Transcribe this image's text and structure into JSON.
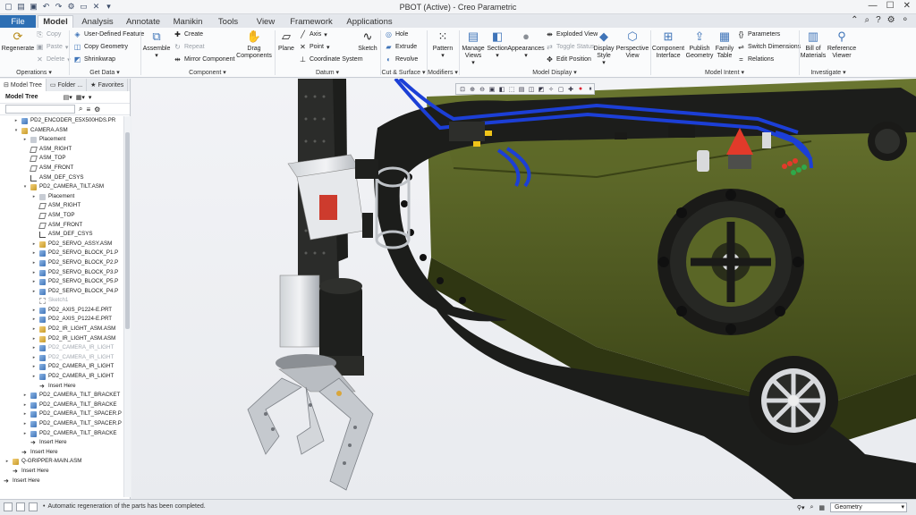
{
  "window": {
    "title": "PBOT (Active) - Creo Parametric"
  },
  "tabs": [
    "File",
    "Model",
    "Analysis",
    "Annotate",
    "Manikin",
    "Tools",
    "View",
    "Framework",
    "Applications"
  ],
  "ribbon": {
    "regenerate": "Regenerate",
    "copy": "Copy",
    "paste": "Paste",
    "delete": "Delete",
    "user_defined_feature": "User-Defined Feature",
    "copy_geometry": "Copy Geometry",
    "shrinkwrap": "Shrinkwrap",
    "assemble": "Assemble",
    "create": "Create",
    "repeat": "Repeat",
    "mirror_component": "Mirror Component",
    "drag_components": "Drag Components",
    "plane": "Plane",
    "axis": "Axis",
    "point": "Point",
    "coordinate_system": "Coordinate System",
    "sketch": "Sketch",
    "hole": "Hole",
    "extrude": "Extrude",
    "revolve": "Revolve",
    "pattern": "Pattern",
    "manage_views": "Manage Views",
    "section": "Section",
    "appearances": "Appearances",
    "exploded_view": "Exploded View",
    "toggle_status": "Toggle Status",
    "edit_position": "Edit Position",
    "display_style": "Display Style",
    "perspective_view": "Perspective View",
    "component_interface": "Component Interface",
    "publish_geometry": "Publish Geometry",
    "family_table": "Family Table",
    "parameters": "Parameters",
    "switch_dimensions": "Switch Dimensions",
    "relations": "Relations",
    "bill_of_materials": "Bill of Materials",
    "reference_viewer": "Reference Viewer",
    "groups": {
      "operations": "Operations ▾",
      "get_data": "Get Data ▾",
      "component": "Component ▾",
      "datum": "Datum ▾",
      "cut_surface": "Cut & Surface ▾",
      "modifiers": "Modifiers ▾",
      "model_display": "Model Display ▾",
      "model_intent": "Model Intent ▾",
      "investigate": "Investigate ▾"
    }
  },
  "panel": {
    "tabs": [
      "Model Tree",
      "Folder ...",
      "Favorites"
    ],
    "title": "Model Tree"
  },
  "tree": [
    {
      "label": "PD2_ENCODER_E5X500HDS.PR",
      "indent": 1,
      "type": "part",
      "exp": "▸"
    },
    {
      "label": "CAMERA.ASM",
      "indent": 1,
      "type": "asm",
      "exp": "▾"
    },
    {
      "label": "Placement",
      "indent": 2,
      "type": "plc",
      "exp": "▸"
    },
    {
      "label": "ASM_RIGHT",
      "indent": 2,
      "type": "datum",
      "exp": ""
    },
    {
      "label": "ASM_TOP",
      "indent": 2,
      "type": "datum",
      "exp": ""
    },
    {
      "label": "ASM_FRONT",
      "indent": 2,
      "type": "datum",
      "exp": ""
    },
    {
      "label": "ASM_DEF_CSYS",
      "indent": 2,
      "type": "csys",
      "exp": ""
    },
    {
      "label": "PD2_CAMERA_TILT.ASM",
      "indent": 2,
      "type": "asm",
      "exp": "▾"
    },
    {
      "label": "Placement",
      "indent": 3,
      "type": "plc",
      "exp": "▸"
    },
    {
      "label": "ASM_RIGHT",
      "indent": 3,
      "type": "datum",
      "exp": ""
    },
    {
      "label": "ASM_TOP",
      "indent": 3,
      "type": "datum",
      "exp": ""
    },
    {
      "label": "ASM_FRONT",
      "indent": 3,
      "type": "datum",
      "exp": ""
    },
    {
      "label": "ASM_DEF_CSYS",
      "indent": 3,
      "type": "csys",
      "exp": ""
    },
    {
      "label": "PD2_SERVO_ASSY.ASM",
      "indent": 3,
      "type": "asm",
      "exp": "▸"
    },
    {
      "label": "PD2_SERVO_BLOCK_P1.P",
      "indent": 3,
      "type": "part",
      "exp": "▸"
    },
    {
      "label": "PD2_SERVO_BLOCK_P2.P",
      "indent": 3,
      "type": "part",
      "exp": "▸"
    },
    {
      "label": "PD2_SERVO_BLOCK_P3.P",
      "indent": 3,
      "type": "part",
      "exp": "▸"
    },
    {
      "label": "PD2_SERVO_BLOCK_P5.P",
      "indent": 3,
      "type": "part",
      "exp": "▸"
    },
    {
      "label": "PD2_SERVO_BLOCK_P4.P",
      "indent": 3,
      "type": "part",
      "exp": "▸"
    },
    {
      "label": "Sketch1",
      "indent": 3,
      "type": "skt",
      "exp": "",
      "dim": true
    },
    {
      "label": "PD2_AXIS_P1224-E.PRT",
      "indent": 3,
      "type": "part",
      "exp": "▸"
    },
    {
      "label": "PD2_AXIS_P1224-E.PRT",
      "indent": 3,
      "type": "part",
      "exp": "▸"
    },
    {
      "label": "PD2_IR_LIGHT_ASM.ASM",
      "indent": 3,
      "type": "asm",
      "exp": "▸"
    },
    {
      "label": "PD2_IR_LIGHT_ASM.ASM",
      "indent": 3,
      "type": "asm",
      "exp": "▸"
    },
    {
      "label": "PD2_CAMERA_IR_LIGHT",
      "indent": 3,
      "type": "part",
      "exp": "▸",
      "dim": true
    },
    {
      "label": "PD2_CAMERA_IR_LIGHT",
      "indent": 3,
      "type": "part",
      "exp": "▸",
      "dim": true
    },
    {
      "label": "PD2_CAMERA_IR_LIGHT",
      "indent": 3,
      "type": "part",
      "exp": "▸"
    },
    {
      "label": "PD2_CAMERA_IR_LIGHT",
      "indent": 3,
      "type": "part",
      "exp": "▸"
    },
    {
      "label": "Insert Here",
      "indent": 3,
      "type": "ins",
      "exp": ""
    },
    {
      "label": "PD2_CAMERA_TILT_BRACKET",
      "indent": 2,
      "type": "part",
      "exp": "▸"
    },
    {
      "label": "PD2_CAMERA_TILT_BRACKE",
      "indent": 2,
      "type": "part",
      "exp": "▸"
    },
    {
      "label": "PD2_CAMERA_TILT_SPACER.P",
      "indent": 2,
      "type": "part",
      "exp": "▸"
    },
    {
      "label": "PD2_CAMERA_TILT_SPACER.P",
      "indent": 2,
      "type": "part",
      "exp": "▸"
    },
    {
      "label": "PD2_CAMERA_TILT_BRACKE",
      "indent": 2,
      "type": "part",
      "exp": "▸"
    },
    {
      "label": "Insert Here",
      "indent": 2,
      "type": "ins",
      "exp": ""
    },
    {
      "label": "Insert Here",
      "indent": 1,
      "type": "ins",
      "exp": ""
    },
    {
      "label": "Q-GRIPPER-MAIN.ASM",
      "indent": 0,
      "type": "asm",
      "exp": "▸"
    },
    {
      "label": "Insert Here",
      "indent": 0,
      "type": "ins",
      "exp": ""
    },
    {
      "label": "Insert Here",
      "indent": -1,
      "type": "ins",
      "exp": ""
    }
  ],
  "status": {
    "message": "Automatic regeneration of the parts has been completed.",
    "filter": "Geometry"
  },
  "colors": {
    "chassis": "#4f5a22",
    "track": "#1b1c1a",
    "hose": "#1c3fd6",
    "accent_red": "#e23a2a",
    "file_tab": "#2d6fb4"
  }
}
